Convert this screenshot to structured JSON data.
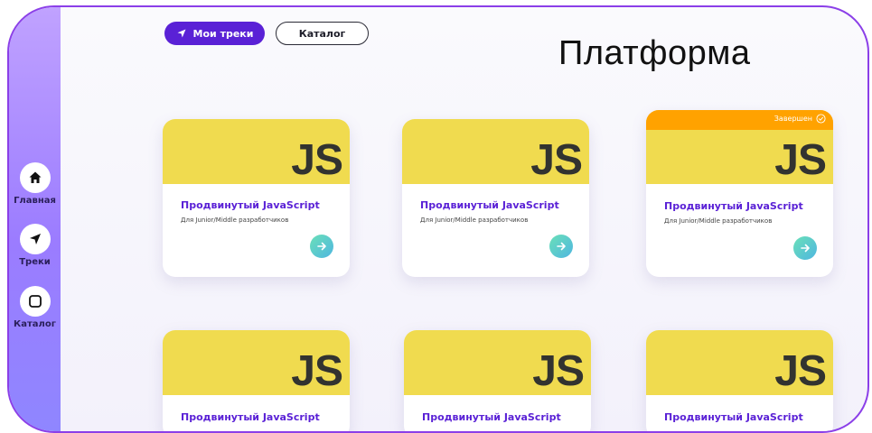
{
  "app": {
    "title": "Платформа"
  },
  "sidebar": {
    "items": [
      {
        "label": "Главная",
        "icon": "home-icon"
      },
      {
        "label": "Треки",
        "icon": "navigation-arrow-icon"
      },
      {
        "label": "Каталог",
        "icon": "square-icon"
      }
    ]
  },
  "header": {
    "my_tracks_label": "Мои треки",
    "catalog_label": "Каталог"
  },
  "cards": [
    {
      "logo": "JS",
      "title": "Продвинутый JavaScript",
      "subtitle": "Для Junior/Middle разработчиков",
      "status": ""
    },
    {
      "logo": "JS",
      "title": "Продвинутый JavaScript",
      "subtitle": "Для Junior/Middle разработчиков",
      "status": ""
    },
    {
      "logo": "JS",
      "title": "Продвинутый JavaScript",
      "subtitle": "Для Junior/Middle разработчиков",
      "status": "Завершен"
    },
    {
      "logo": "JS",
      "title": "Продвинутый JavaScript"
    },
    {
      "logo": "JS",
      "title": "Продвинутый JavaScript"
    },
    {
      "logo": "JS",
      "title": "Продвинутый JavaScript"
    }
  ],
  "colors": {
    "accent": "#5a21d6",
    "js_yellow": "#f0db4f",
    "done_orange": "#ffa200",
    "frame": "#8b3fe8"
  }
}
